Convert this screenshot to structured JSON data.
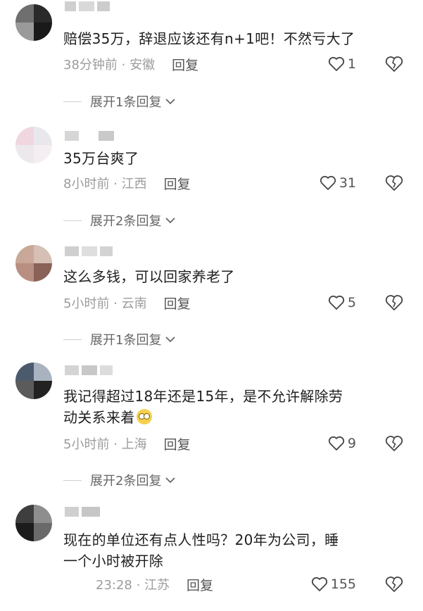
{
  "comments": [
    {
      "text": "赔偿35万，辞退应该还有n+1吧！不然亏大了",
      "time_location": "38分钟前 · 安徽",
      "reply_label": "回复",
      "likes": "1",
      "expand": "展开1条回复"
    },
    {
      "text": "35万台爽了",
      "time_location": "8小时前 · 江西",
      "reply_label": "回复",
      "likes": "31",
      "expand": "展开2条回复"
    },
    {
      "text": "这么多钱，可以回家养老了",
      "time_location": "5小时前 · 云南",
      "reply_label": "回复",
      "likes": "5",
      "expand": "展开1条回复"
    },
    {
      "text_line1": "我记得超过18年还是15年，是不允许解除劳",
      "text_line2": "动关系来着",
      "emoji_icon": "rolling-eyes-emoji-icon",
      "time_location": "5小时前 · 上海",
      "reply_label": "回复",
      "likes": "9",
      "expand": "展开2条回复"
    },
    {
      "text_line1": "现在的单位还有点人性吗？20年为公司，睡",
      "text_line2": "一个小时被开除",
      "time_location": "23:28 · 江苏",
      "reply_label": "回复",
      "likes": "155"
    }
  ],
  "icons": {
    "like": "heart-icon",
    "dislike": "broken-heart-icon",
    "expand": "chevron-down-icon"
  }
}
